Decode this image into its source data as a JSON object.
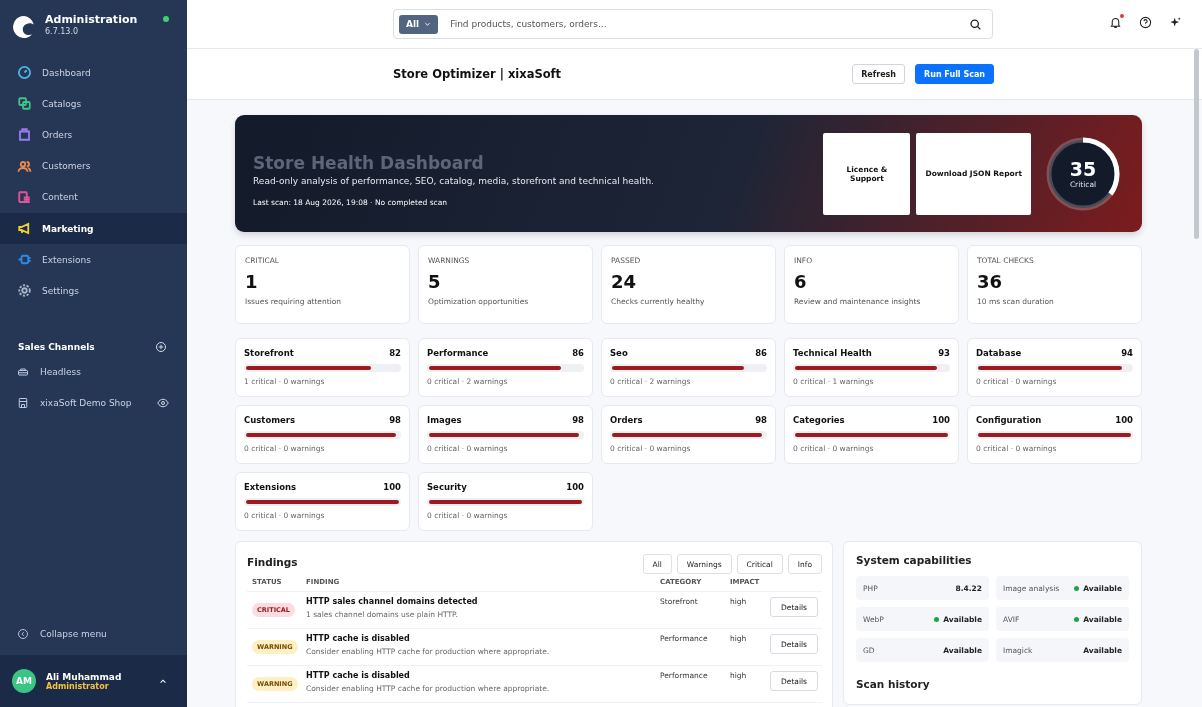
{
  "brand": {
    "title": "Administration",
    "version": "6.7.13.0",
    "online": true
  },
  "nav": [
    {
      "label": "Dashboard",
      "color": "#4fb3e8",
      "selected": false
    },
    {
      "label": "Catalogs",
      "color": "#3fc48a",
      "selected": false
    },
    {
      "label": "Orders",
      "color": "#9a7cf0",
      "selected": false
    },
    {
      "label": "Customers",
      "color": "#f08a4b",
      "selected": false
    },
    {
      "label": "Content",
      "color": "#e0559a",
      "selected": false
    },
    {
      "label": "Marketing",
      "color": "#f2d22e",
      "selected": true
    },
    {
      "label": "Extensions",
      "color": "#2f8de4",
      "selected": false
    },
    {
      "label": "Settings",
      "color": "#aab4c6",
      "selected": false
    }
  ],
  "sales_channels": {
    "title": "Sales Channels",
    "items": [
      {
        "label": "Headless",
        "visible_toggle": false
      },
      {
        "label": "xixaSoft Demo Shop",
        "visible_toggle": true
      }
    ]
  },
  "collapse": "Collapse menu",
  "user": {
    "initials": "AM",
    "name": "Ali Muhammad",
    "role": "Administrator"
  },
  "search": {
    "scope": "All",
    "placeholder": "Find products, customers, orders..."
  },
  "notifications": {
    "unread": true
  },
  "page_title": "Store Optimizer | xixaSoft",
  "actions": [
    "Refresh",
    "Run Full Scan"
  ],
  "hero": {
    "title": "Store Health Dashboard",
    "subtitle": "Read-only analysis of performance, SEO, catalog, media, storefront and technical health.",
    "last_scan": "Last scan: 18 Aug 2026, 19:08 · No completed scan",
    "buttons": [
      "Licence & Support",
      "Download JSON Report"
    ],
    "score": "35",
    "score_label": "Critical",
    "level": 0.35
  },
  "stats": [
    {
      "label": "CRITICAL",
      "value": "1",
      "note": "Issues requiring attention"
    },
    {
      "label": "WARNINGS",
      "value": "5",
      "note": "Optimization opportunities"
    },
    {
      "label": "PASSED",
      "value": "24",
      "note": "Checks currently healthy"
    },
    {
      "label": "INFO",
      "value": "6",
      "note": "Review and maintenance insights"
    },
    {
      "label": "TOTAL CHECKS",
      "value": "36",
      "note": "10 ms scan duration"
    }
  ],
  "categories": [
    {
      "name": "Storefront",
      "score": "82",
      "level": 0.82,
      "summary": "1 critical · 0 warnings"
    },
    {
      "name": "Performance",
      "score": "86",
      "level": 0.86,
      "summary": "0 critical · 2 warnings"
    },
    {
      "name": "Seo",
      "score": "86",
      "level": 0.86,
      "summary": "0 critical · 2 warnings"
    },
    {
      "name": "Technical Health",
      "score": "93",
      "level": 0.93,
      "summary": "0 critical · 1 warnings"
    },
    {
      "name": "Database",
      "score": "94",
      "level": 0.94,
      "summary": "0 critical · 0 warnings"
    },
    {
      "name": "Customers",
      "score": "98",
      "level": 0.98,
      "summary": "0 critical · 0 warnings"
    },
    {
      "name": "Images",
      "score": "98",
      "level": 0.98,
      "summary": "0 critical · 0 warnings"
    },
    {
      "name": "Orders",
      "score": "98",
      "level": 0.98,
      "summary": "0 critical · 0 warnings"
    },
    {
      "name": "Categories",
      "score": "100",
      "level": 1,
      "summary": "0 critical · 0 warnings"
    },
    {
      "name": "Configuration",
      "score": "100",
      "level": 1,
      "summary": "0 critical · 0 warnings"
    },
    {
      "name": "Extensions",
      "score": "100",
      "level": 1,
      "summary": "0 critical · 0 warnings"
    },
    {
      "name": "Security",
      "score": "100",
      "level": 1,
      "summary": "0 critical · 0 warnings"
    }
  ],
  "findings": {
    "title": "Findings",
    "filters": [
      "All",
      "Warnings",
      "Critical",
      "Info"
    ],
    "columns": [
      "STATUS",
      "FINDING",
      "CATEGORY",
      "IMPACT"
    ],
    "rows": [
      {
        "kind": "critical",
        "status": "CRITICAL",
        "title": "HTTP sales channel domains detected",
        "description": "1 sales channel domains use plain HTTP.",
        "category": "Storefront",
        "impact": "high",
        "action": "Details"
      },
      {
        "kind": "warning",
        "status": "WARNING",
        "title": "HTTP cache is disabled",
        "description": "Consider enabling HTTP cache for production where appropriate.",
        "category": "Performance",
        "impact": "high",
        "action": "Details"
      },
      {
        "kind": "warning",
        "status": "WARNING",
        "title": "HTTP cache is disabled",
        "description": "Consider enabling HTTP cache for production where appropriate.",
        "category": "Performance",
        "impact": "high",
        "action": "Details"
      }
    ]
  },
  "capabilities": {
    "title": "System capabilities",
    "items": [
      {
        "label": "PHP",
        "value": "8.4.22",
        "indicator": false
      },
      {
        "label": "Image analysis",
        "value": "Available",
        "indicator": true
      },
      {
        "label": "WebP",
        "value": "Available",
        "indicator": true
      },
      {
        "label": "AVIF",
        "value": "Available",
        "indicator": true
      },
      {
        "label": "GD",
        "value": "Available",
        "indicator": false
      },
      {
        "label": "Imagick",
        "value": "Available",
        "indicator": false
      }
    ]
  },
  "scan_history": {
    "title": "Scan history"
  }
}
